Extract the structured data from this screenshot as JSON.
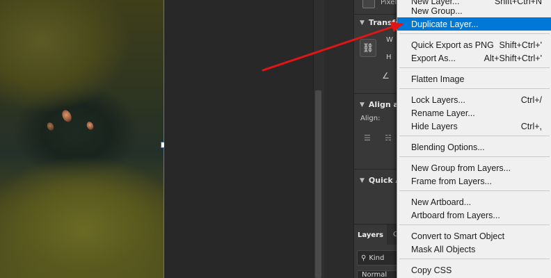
{
  "panel": {
    "pixel_label": "Pixel",
    "transform_heading": "Transform",
    "w_label": "W",
    "h_label": "H",
    "align_heading": "Align an",
    "align_label": "Align:",
    "quick_heading": "Quick A",
    "layers_tab": "Layers",
    "other_tab": "C",
    "kind_label": "Kind",
    "blend_mode": "Normal"
  },
  "menu": {
    "items": [
      {
        "label": "New Layer...",
        "shortcut": "Shift+Ctrl+N"
      },
      {
        "label": "New Group...",
        "shortcut": ""
      },
      {
        "label": "Duplicate Layer...",
        "shortcut": "",
        "highlighted": true
      },
      {
        "label": "Quick Export as PNG",
        "shortcut": "Shift+Ctrl+'"
      },
      {
        "label": "Export As...",
        "shortcut": "Alt+Shift+Ctrl+'"
      },
      {
        "label": "Flatten Image",
        "shortcut": ""
      },
      {
        "label": "Lock Layers...",
        "shortcut": "Ctrl+/"
      },
      {
        "label": "Rename Layer...",
        "shortcut": ""
      },
      {
        "label": "Hide Layers",
        "shortcut": "Ctrl+,"
      },
      {
        "label": "Blending Options...",
        "shortcut": ""
      },
      {
        "label": "New Group from Layers...",
        "shortcut": ""
      },
      {
        "label": "Frame from Layers...",
        "shortcut": ""
      },
      {
        "label": "New Artboard...",
        "shortcut": ""
      },
      {
        "label": "Artboard from Layers...",
        "shortcut": ""
      },
      {
        "label": "Convert to Smart Object",
        "shortcut": ""
      },
      {
        "label": "Mask All Objects",
        "shortcut": ""
      },
      {
        "label": "Copy CSS",
        "shortcut": ""
      }
    ]
  },
  "colors": {
    "highlight": "#0078d7",
    "arrow": "#e01515",
    "menu_bg": "#f0f0f0",
    "panel_bg": "#383838"
  },
  "icons": [
    "link-icon",
    "angle-icon",
    "align-left-icon",
    "align-center-icon",
    "search-icon",
    "chevron-down-icon",
    "pixel-layer-icon"
  ]
}
